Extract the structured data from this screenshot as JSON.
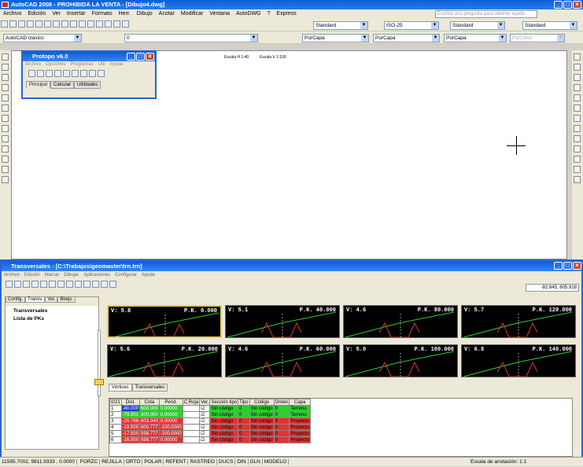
{
  "app": {
    "title": "AutoCAD 2008 - PROHIBIDA LA VENTA - [Dibujo4.dwg]"
  },
  "menu": [
    "Archivo",
    "Edición",
    "Ver",
    "Insertar",
    "Formato",
    "Herr.",
    "Dibujo",
    "Acotar",
    "Modificar",
    "Ventana",
    "AutoDWG",
    "?",
    "Express"
  ],
  "help_search": {
    "placeholder": "Escriba una pregunta para obtener ayuda"
  },
  "toolbar": {
    "workspace": "AutoCAD clásico",
    "layer": "0",
    "textstyle": "Standard",
    "dimstyle": "ISO-25",
    "tablestyle": "Standard",
    "mlstyle": "Standard",
    "color": "PorCapa",
    "linetype": "PorCapa",
    "lineweight": "PorCapa",
    "plotstyle": "PorColor"
  },
  "drawing": {
    "header_left": "Escala H 1:40",
    "header_right": "Escala V 1:100"
  },
  "protopo": {
    "title": "Protopo v6.0",
    "menu": [
      "Archivo",
      "Opciones",
      "Programas",
      "Util",
      "Ayuda"
    ],
    "tabs": [
      "Principal",
      "Calcular",
      "Utilidades"
    ]
  },
  "transv": {
    "title": "Transversales - [C:\\Trabajos\\geomaster\\trn.trn]",
    "menu": [
      "Archivo",
      "Edición",
      "Marcar",
      "Dibujar",
      "Aplicaciones",
      "Configurar",
      "Ayuda"
    ],
    "coords": "-82.645, 605.918",
    "side_tabs": [
      "Config.",
      "Transv.",
      "Vol.",
      "Bloqs."
    ],
    "tree": [
      "Transversales",
      "Lista de PKs"
    ],
    "panels": [
      {
        "v": "V: 5.8",
        "pk": "P.K. 0.000"
      },
      {
        "v": "V: 5.1",
        "pk": "P.K. 40.000"
      },
      {
        "v": "V: 4.6",
        "pk": "P.K. 80.000"
      },
      {
        "v": "V: 5.7",
        "pk": "P.K. 120.000"
      },
      {
        "v": "V: 5.6",
        "pk": "P.K. 20.000"
      },
      {
        "v": "V: 4.6",
        "pk": "P.K. 60.000"
      },
      {
        "v": "V: 5.0",
        "pk": "P.K. 100.000"
      },
      {
        "v": "V: 6.8",
        "pk": "P.K. 140.000"
      }
    ],
    "bottom_tabs": [
      "Vértices",
      "Transversales"
    ],
    "table": {
      "headers": [
        "0/21",
        "Dist.",
        "Cota",
        "Pend.",
        "C.Roja",
        "Ver.",
        "Sección tipo",
        "Tipo",
        "Código",
        "Orden",
        "Capa"
      ],
      "rows": [
        {
          "n": "1",
          "dist": "-80.000",
          "cota": "600.000",
          "pend": "0.00000",
          "roja": "",
          "sec": "Sin código",
          "tipo": "0",
          "cod": "Sin código",
          "ord": "0",
          "capa": "Terreno",
          "color": "#33cc33"
        },
        {
          "n": "2",
          "dist": "-79.301",
          "cota": "600.000",
          "pend": "0.00000",
          "roja": "",
          "sec": "Sin código",
          "tipo": "0",
          "cod": "Sin código",
          "ord": "0",
          "capa": "Terreno",
          "color": "#33cc33"
        },
        {
          "n": "3",
          "dist": "-20.766",
          "cota": "603.043",
          "pend": "0.00000",
          "roja": "",
          "sec": "Sin código",
          "tipo": "0",
          "cod": "Sin código",
          "ord": "0",
          "capa": "Proyecto",
          "color": "#e83030"
        },
        {
          "n": "4",
          "dist": "-18.500",
          "cota": "600.777",
          "pend": "-100.0000",
          "roja": "",
          "sec": "Sin código",
          "tipo": "0",
          "cod": "Sin código",
          "ord": "0",
          "capa": "Proyecto",
          "color": "#e83030"
        },
        {
          "n": "5",
          "dist": "-17.500",
          "cota": "598.777",
          "pend": "-100.0000",
          "roja": "",
          "sec": "Sin código",
          "tipo": "0",
          "cod": "Sin código",
          "ord": "0",
          "capa": "Proyecto",
          "color": "#e83030"
        },
        {
          "n": "6",
          "dist": "-16.500",
          "cota": "598.777",
          "pend": "0.00000",
          "roja": "",
          "sec": "Sin código",
          "tipo": "0",
          "cod": "Sin código",
          "ord": "0",
          "capa": "Proyecto",
          "color": "#e83030"
        }
      ]
    }
  },
  "status": {
    "coords": "11595.7002, 9811.9333 , 0.0000",
    "toggles": [
      "FORZC",
      "REJILLA",
      "ORTO",
      "POLAR",
      "REFENT",
      "RASTREO",
      "DUCS",
      "DIN",
      "GLN",
      "MODELO"
    ],
    "scale": "Escala de anotación: 1:1"
  }
}
